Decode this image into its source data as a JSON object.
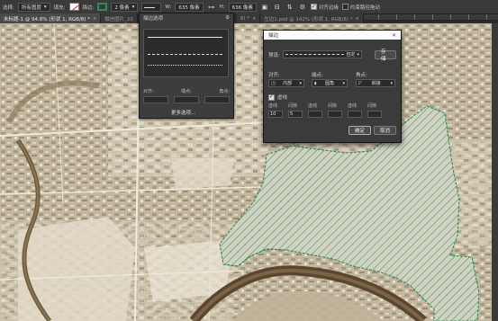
{
  "options_bar": {
    "select_label": "选择:",
    "select_value": "所有图层",
    "fill_label": "填充:",
    "stroke_label": "描边:",
    "stroke_width": "2 像素",
    "w_label": "W:",
    "w_value": "635 像素",
    "h_label": "H:",
    "h_value": "636 像素",
    "align_edges": "对齐边缘",
    "constrain_path": "约束路径拖动"
  },
  "tabs": [
    {
      "label": "未标题-1 @ 94.8% (形状 1, RGB/8) *",
      "active": true
    },
    {
      "label": "微信图片_20",
      "active": false
    },
    {
      "label": "8) *",
      "active": false
    },
    {
      "label": "左边1.psd @ 142% (形状 1, RGB/8) *",
      "active": false
    }
  ],
  "stroke_panel": {
    "title": "描边选项",
    "align_label": "对齐:",
    "endpoints_label": "端点:",
    "corners_label": "角点:",
    "more_options": "更多选项..."
  },
  "dialog": {
    "title": "描边",
    "preset_label": "预设:",
    "preset_value": "自定",
    "save_button": "存储",
    "align_label": "对齐:",
    "align_value": "内部",
    "endpoints_label": "端点:",
    "endpoints_value": "圆角",
    "corners_label": "角点:",
    "corners_value": "斜接",
    "dashed_label": "虚线",
    "dashed_checked": true,
    "dash_label": "虚线",
    "gap_label": "间隙",
    "dash_values": [
      "10",
      "5",
      "",
      "",
      "",
      ""
    ],
    "ok_button": "确定",
    "cancel_button": "取消"
  },
  "colors": {
    "stroke_green": "#2e8b57",
    "hatch_green": "#7f9a76",
    "map_base": "#c8bda7"
  }
}
